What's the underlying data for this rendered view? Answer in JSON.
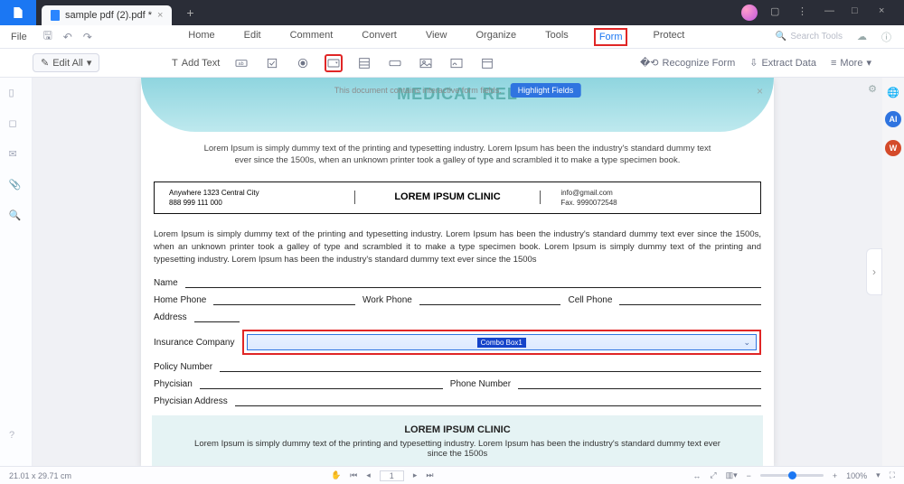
{
  "titlebar": {
    "tab_name": "sample pdf (2).pdf *"
  },
  "menubar": {
    "file": "File",
    "items": [
      "Home",
      "Edit",
      "Comment",
      "Convert",
      "View",
      "Organize",
      "Tools",
      "Form",
      "Protect"
    ],
    "highlighted": "Form",
    "search_placeholder": "Search Tools"
  },
  "ribbon": {
    "edit_all": "Edit All",
    "add_text": "Add Text",
    "recognize": "Recognize Form",
    "extract": "Extract Data",
    "more": "More"
  },
  "sidebar_right": {
    "sliders_icon": "sliders",
    "ai": "AI",
    "w": "W"
  },
  "banner": {
    "title": "MEDICAL REL",
    "strip_text": "This document contains interactive form fields.",
    "highlight_btn": "Highlight Fields"
  },
  "doc": {
    "intro": "Lorem Ipsum is simply dummy text of the printing and typesetting industry. Lorem Ipsum has been the industry's standard dummy text ever since the 1500s, when an unknown printer took a galley of type and scrambled it to make a type specimen book.",
    "addr1": "Anywhere 1323 Central City",
    "addr2": "888 999 111 000",
    "clinic": "LOREM IPSUM CLINIC",
    "email": "info@gmail.com",
    "fax": "Fax. 9990072548",
    "para": "Lorem Ipsum is simply dummy text of the printing and typesetting industry. Lorem Ipsum has been the industry's standard dummy text ever since the 1500s, when an unknown printer took a galley of type and scrambled it to make a type specimen book. Lorem Ipsum is simply dummy text of the printing and typesetting industry. Lorem Ipsum has been the industry's standard dummy text ever since the 1500s",
    "labels": {
      "name": "Name",
      "home": "Home Phone",
      "work": "Work Phone",
      "cell": "Cell Phone",
      "address": "Address",
      "ins": "Insurance Company",
      "policy": "Policy Number",
      "phys": "Phycisian",
      "phone": "Phone Number",
      "physaddr": "Phycisian Address"
    },
    "combo_label": "Combo Box1",
    "footer_title": "LOREM IPSUM CLINIC",
    "footer_text": "Lorem Ipsum is simply dummy text of the printing and typesetting industry. Lorem Ipsum has been the industry's standard dummy text ever since the 1500s"
  },
  "status": {
    "dims": "21.01 x 29.71 cm",
    "page": "1",
    "zoom": "100%"
  }
}
